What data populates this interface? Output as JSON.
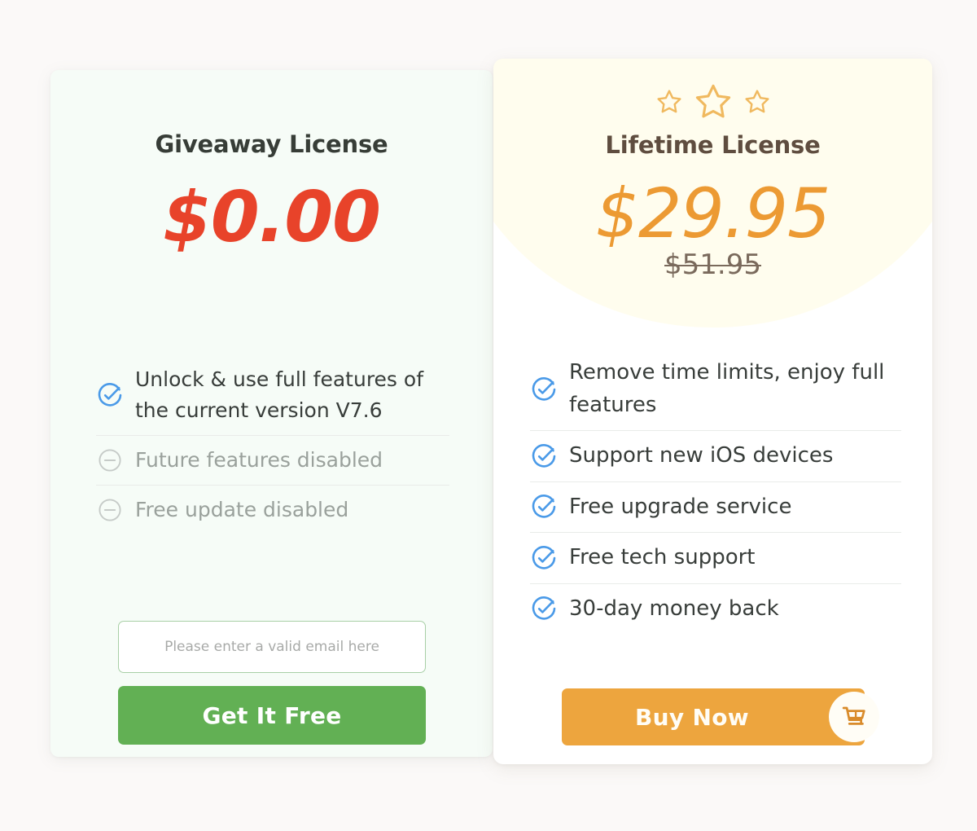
{
  "page": {
    "background_color": "#FBF9F8"
  },
  "free_plan": {
    "title": "Giveaway License",
    "price": "$0.00",
    "price_color": "#E8432A",
    "card_background": "#F6FCF7",
    "features": [
      {
        "text": "Unlock & use full features of the current version V7.6",
        "icon": "check-circle-icon",
        "enabled": true
      },
      {
        "text": "Future features disabled",
        "icon": "minus-circle-icon",
        "enabled": false
      },
      {
        "text": "Free update disabled",
        "icon": "minus-circle-icon",
        "enabled": false
      }
    ],
    "email_input": {
      "placeholder": "Please enter a valid email here",
      "value": ""
    },
    "cta_label": "Get It Free",
    "cta_color": "#62B054"
  },
  "paid_plan": {
    "title": "Lifetime License",
    "price": "$29.95",
    "old_price": "$51.95",
    "price_color": "#EC9A33",
    "card_background": "#FFFFFF",
    "banner_color": "#FFFDEE",
    "stars": [
      "star-outline-icon",
      "star-outline-icon",
      "star-outline-icon"
    ],
    "star_color": "#F0B95F",
    "features": [
      {
        "text": "Remove time limits, enjoy full features",
        "icon": "check-circle-icon",
        "enabled": true
      },
      {
        "text": "Support new iOS devices",
        "icon": "check-circle-icon",
        "enabled": true
      },
      {
        "text": "Free upgrade service",
        "icon": "check-circle-icon",
        "enabled": true
      },
      {
        "text": "Free tech support",
        "icon": "check-circle-icon",
        "enabled": true
      },
      {
        "text": "30-day money back",
        "icon": "check-circle-icon",
        "enabled": true
      }
    ],
    "cta_label": "Buy Now",
    "cta_color": "#EDA53E",
    "cta_icon": "shopping-cart-icon"
  }
}
